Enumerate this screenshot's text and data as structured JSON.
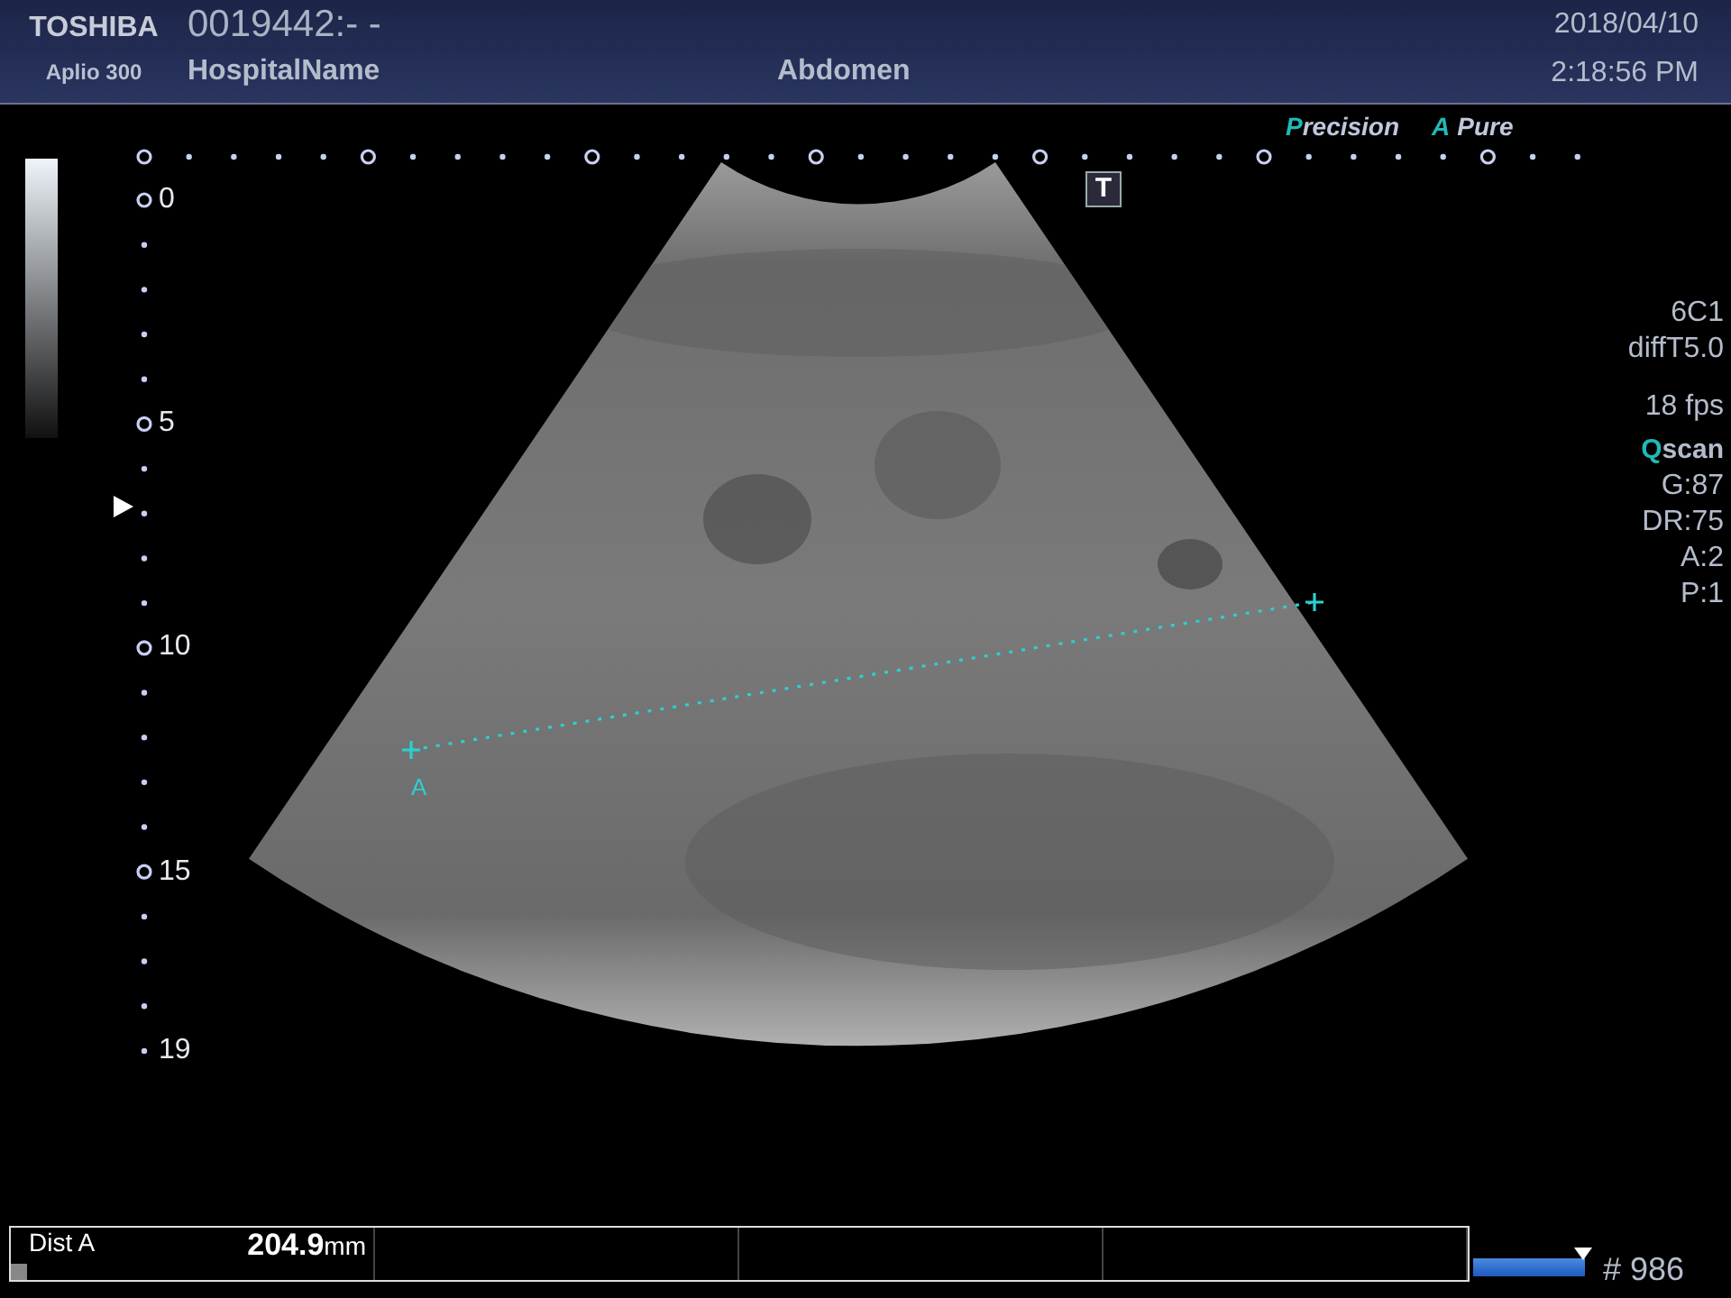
{
  "header": {
    "brand": "TOSHIBA",
    "model": "Aplio 300",
    "patient_id": "0019442:- -",
    "hospital": "HospitalName",
    "exam": "Abdomen",
    "date": "2018/04/10",
    "time": "2:18:56 PM"
  },
  "image_modes": [
    {
      "accent": "P",
      "text": "recision"
    },
    {
      "accent": "A",
      "text": "Pure"
    }
  ],
  "transducer_icon": "T",
  "depth_scale": {
    "labels": [
      "0",
      "5",
      "10",
      "15",
      "19"
    ]
  },
  "measurement": {
    "label": "A"
  },
  "parameters": [
    {
      "kind": "plain",
      "text": "6C1"
    },
    {
      "kind": "plain",
      "text": "diffT5.0"
    },
    {
      "kind": "spaced",
      "text": "18 fps"
    },
    {
      "kind": "accent",
      "accent": "Q",
      "text": "scan"
    },
    {
      "kind": "plain",
      "text": "G:87"
    },
    {
      "kind": "plain",
      "text": "DR:75"
    },
    {
      "kind": "plain",
      "text": "A:2"
    },
    {
      "kind": "plain",
      "text": "P:1"
    }
  ],
  "results": [
    {
      "name": "Dist A",
      "value": "204.9",
      "unit": "mm"
    }
  ],
  "cine": {
    "level": 1,
    "frame": "# 986"
  }
}
